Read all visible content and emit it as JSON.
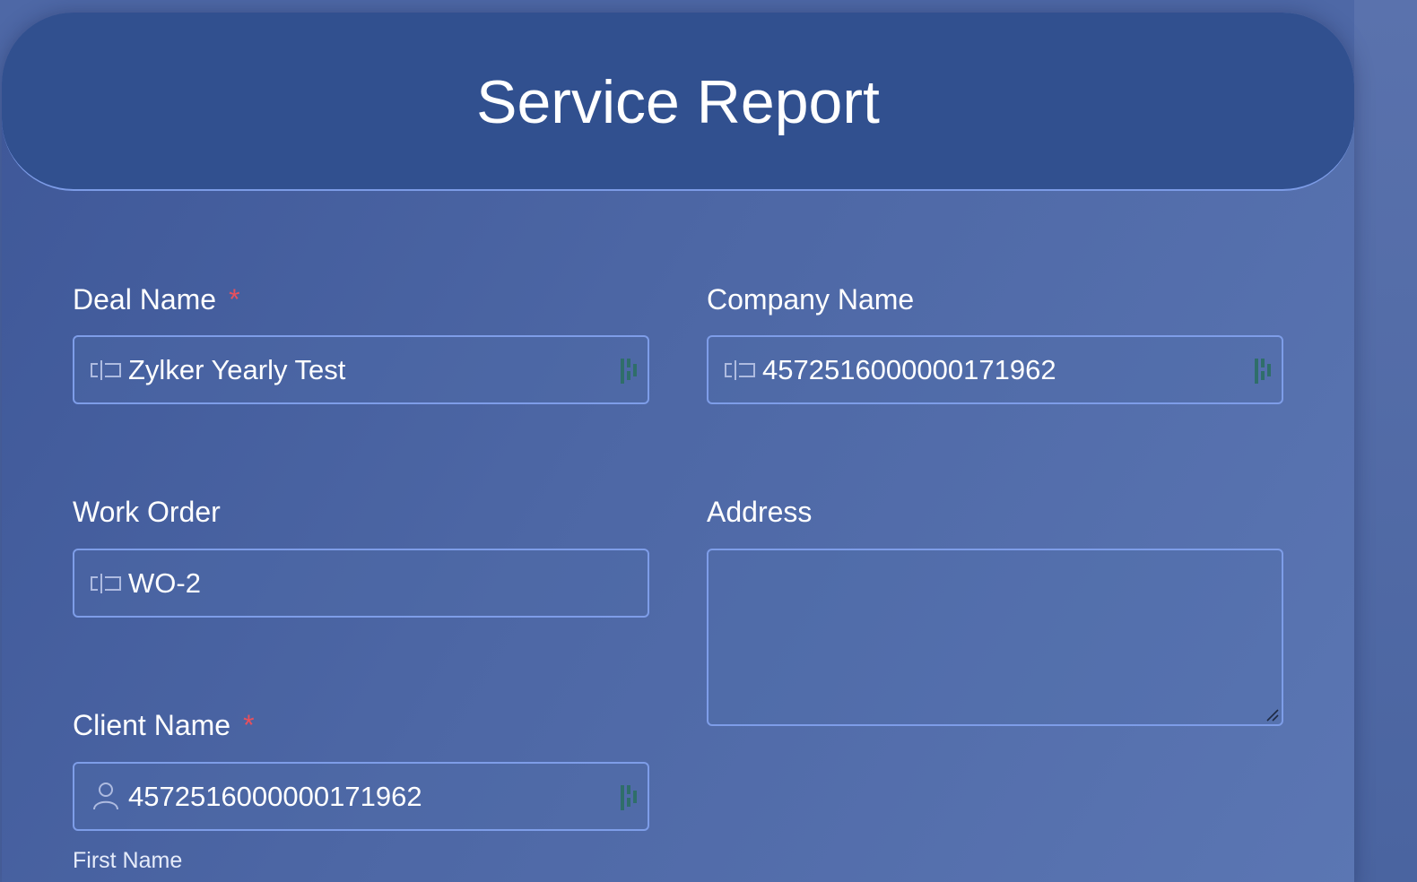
{
  "header": {
    "title": "Service Report"
  },
  "fields": {
    "deal_name": {
      "label": "Deal Name",
      "required_mark": "*",
      "value": "Zylker Yearly Test"
    },
    "company_name": {
      "label": "Company Name",
      "value": "4572516000000171962"
    },
    "work_order": {
      "label": "Work Order",
      "value": "WO-2"
    },
    "address": {
      "label": "Address",
      "value": ""
    },
    "client_name": {
      "label": "Client Name",
      "required_mark": "*",
      "value": "4572516000000171962",
      "sub_label": "First Name"
    }
  },
  "colors": {
    "background": "#4e68a6",
    "header": "#31508f",
    "field_border": "#7e9de8",
    "required": "#e8505c",
    "lookup_icon": "#2f6e6a"
  }
}
